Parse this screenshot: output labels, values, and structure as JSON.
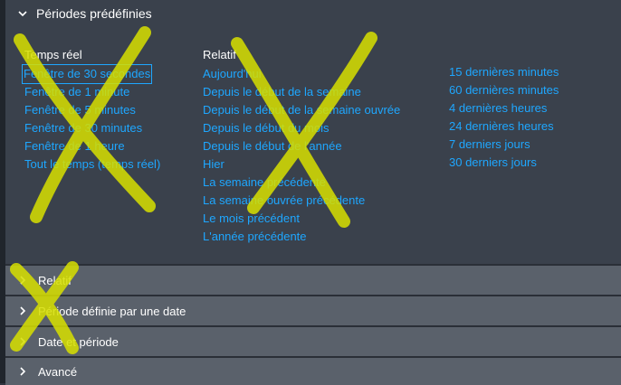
{
  "expanded_section": {
    "title": "Périodes prédéfinies"
  },
  "presets": {
    "realtime_heading": "Temps réel",
    "realtime": [
      "Fenêtre de 30 secondes",
      "Fenêtre de 1 minute",
      "Fenêtre de 5 minutes",
      "Fenêtre de 30 minutes",
      "Fenêtre de 1 heure",
      "Tout le temps (temps réel)"
    ],
    "relative_heading": "Relatif",
    "relative": [
      "Aujourd'hui",
      "Depuis le début de la semaine",
      "Depuis le début de la semaine ouvrée",
      "Depuis le début du mois",
      "Depuis le début de l'année",
      "Hier",
      "La semaine précédente",
      "La semaine ouvrée précédente",
      "Le mois précédent",
      "L'année précédente"
    ],
    "recent": [
      "15 dernières minutes",
      "60 dernières minutes",
      "4 dernières heures",
      "24 dernières heures",
      "7 derniers jours",
      "30 derniers jours"
    ],
    "selected": "Fenêtre de 30 secondes"
  },
  "collapsed_sections": [
    "Relatif",
    "Période définie par une date",
    "Date et période",
    "Avancé"
  ],
  "colors": {
    "link": "#1ea7ff",
    "panel": "#3a414c",
    "row": "#5a616b",
    "marker": "#d8e000"
  },
  "icons": {
    "expanded": "chevron-down-icon",
    "collapsed": "chevron-right-icon"
  }
}
